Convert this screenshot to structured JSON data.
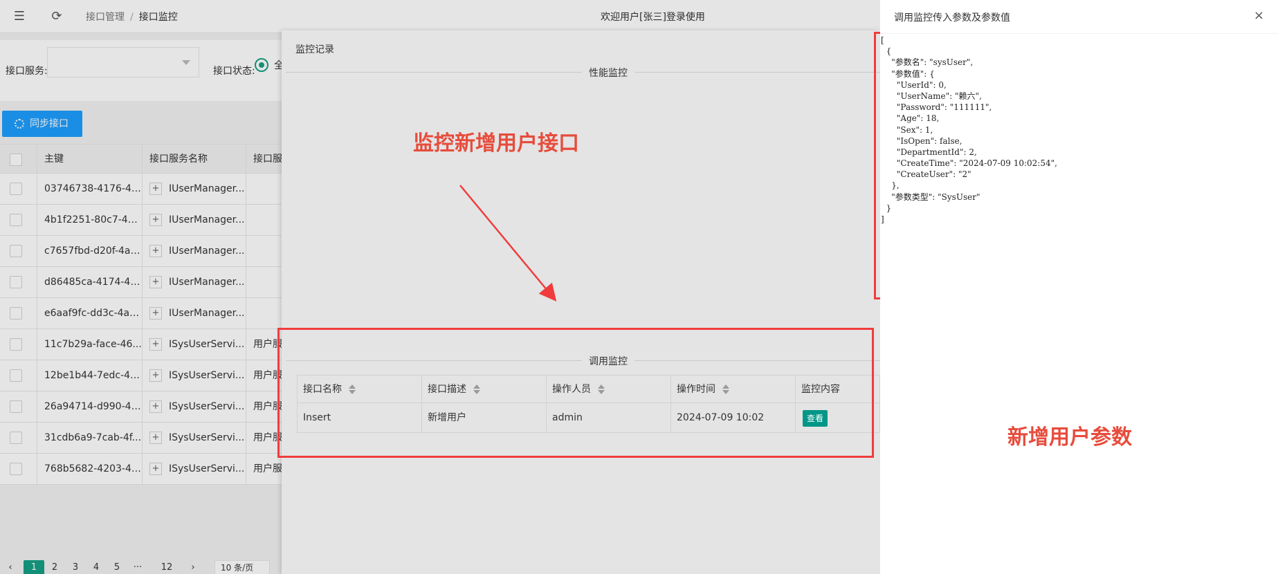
{
  "topbar": {
    "menu_icon": "☰",
    "refresh_icon": "⟳",
    "breadcrumb": [
      "接口管理",
      "接口监控"
    ],
    "breadcrumb_sep": "/",
    "welcome": "欢迎用户[张三]登录使用"
  },
  "filter": {
    "service_label": "接口服务:",
    "service_value": "",
    "status_label": "接口状态:",
    "status_option": "全"
  },
  "toolbar": {
    "sync_label": "同步接口"
  },
  "grid": {
    "headers": [
      "主键",
      "接口服务名称",
      "接口服"
    ],
    "rows": [
      {
        "id": "03746738-4176-43...",
        "service": "IUserManager...",
        "desc": ""
      },
      {
        "id": "4b1f2251-80c7-44...",
        "service": "IUserManager...",
        "desc": ""
      },
      {
        "id": "c7657fbd-d20f-4ad...",
        "service": "IUserManager...",
        "desc": ""
      },
      {
        "id": "d86485ca-4174-41...",
        "service": "IUserManager...",
        "desc": ""
      },
      {
        "id": "e6aaf9fc-dd3c-4a4...",
        "service": "IUserManager...",
        "desc": ""
      },
      {
        "id": "11c7b29a-face-46...",
        "service": "ISysUserServi...",
        "desc": "用户服"
      },
      {
        "id": "12be1b44-7edc-45...",
        "service": "ISysUserServi...",
        "desc": "用户服"
      },
      {
        "id": "26a94714-d990-40...",
        "service": "ISysUserServi...",
        "desc": "用户服"
      },
      {
        "id": "31cdb6a9-7cab-4f...",
        "service": "ISysUserServi...",
        "desc": "用户服"
      },
      {
        "id": "768b5682-4203-46...",
        "service": "ISysUserServi...",
        "desc": "用户服"
      }
    ]
  },
  "pager": {
    "prev": "‹",
    "pages": [
      "1",
      "2",
      "3",
      "4",
      "5",
      "···",
      "12"
    ],
    "next": "›",
    "page_size": "10 条/页",
    "current_page": 1
  },
  "record": {
    "title": "监控记录",
    "perf_label": "性能监控",
    "annotation": "监控新增用户接口",
    "call_label": "调用监控",
    "table": {
      "headers": [
        "接口名称",
        "接口描述",
        "操作人员",
        "操作时间",
        "监控内容"
      ],
      "row": {
        "name": "Insert",
        "desc": "新增用户",
        "operator": "admin",
        "time": "2024-07-09 10:02",
        "action": "查看"
      }
    }
  },
  "drawer": {
    "title": "调用监控传入参数及参数值",
    "close_icon": "×",
    "json_lines": [
      "[",
      "  {",
      "    \"参数名\": \"sysUser\",",
      "    \"参数值\": {",
      "      \"UserId\": 0,",
      "      \"UserName\": \"赖六\",",
      "      \"Password\": \"111111\",",
      "      \"Age\": 18,",
      "      \"Sex\": 1,",
      "      \"IsOpen\": false,",
      "      \"DepartmentId\": 2,",
      "      \"CreateTime\": \"2024-07-09 10:02:54\",",
      "      \"CreateUser\": \"2\"",
      "    },",
      "    \"参数类型\": \"SysUser\"",
      "  }",
      "]"
    ],
    "annotation": "新增用户参数"
  },
  "colors": {
    "accent_green": "#16a085",
    "button_green": "#009688",
    "sync_blue": "#1e9fff",
    "annotation_red": "#e74c3c"
  }
}
